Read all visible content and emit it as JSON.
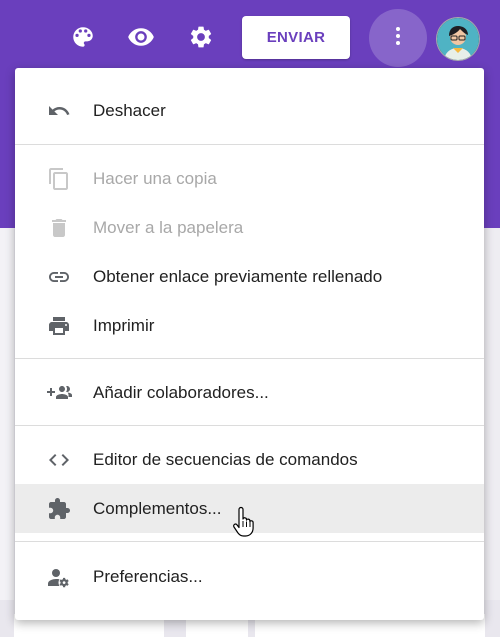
{
  "toolbar": {
    "send_label": "ENVIAR",
    "icons": [
      "palette-icon",
      "eye-icon",
      "gear-icon",
      "more-vert-icon"
    ]
  },
  "menu": {
    "items": [
      {
        "label": "Deshacer",
        "icon": "undo-icon",
        "enabled": true
      },
      {
        "label": "Hacer una copia",
        "icon": "copy-icon",
        "enabled": false
      },
      {
        "label": "Mover a la papelera",
        "icon": "trash-icon",
        "enabled": false
      },
      {
        "label": "Obtener enlace previamente rellenado",
        "icon": "link-icon",
        "enabled": true
      },
      {
        "label": "Imprimir",
        "icon": "print-icon",
        "enabled": true
      },
      {
        "label": "Añadir colaboradores...",
        "icon": "add-people-icon",
        "enabled": true
      },
      {
        "label": "Editor de secuencias de comandos",
        "icon": "code-icon",
        "enabled": true
      },
      {
        "label": "Complementos...",
        "icon": "puzzle-icon",
        "enabled": true,
        "hovered": true
      },
      {
        "label": "Preferencias...",
        "icon": "user-settings-icon",
        "enabled": true
      }
    ]
  },
  "colors": {
    "brand": "#6a3fbd",
    "menu_bg": "#ffffff",
    "hover_bg": "#ececec",
    "text": "#212121",
    "disabled_text": "#a8a8a8"
  }
}
